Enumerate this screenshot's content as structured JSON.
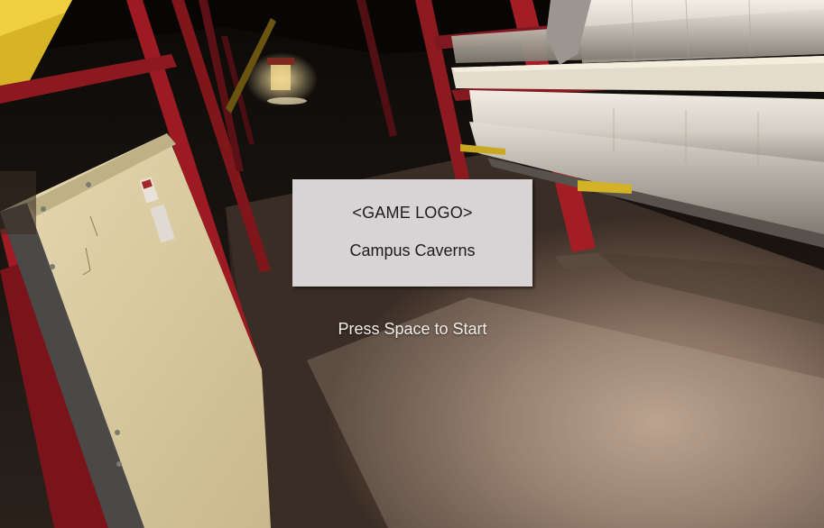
{
  "title_screen": {
    "logo_placeholder": "<GAME LOGO>",
    "game_title": "Campus Caverns",
    "start_prompt": "Press Space to Start"
  },
  "colors": {
    "panel_background": "#d8d4d5",
    "panel_text": "#1c1c1c",
    "prompt_text": "#f2efea",
    "steel_beam": "#a01c24",
    "insulated_pipe": "#d9d5cc",
    "concrete_floor": "#6e5a4c",
    "plywood_crate": "#d8c99e"
  }
}
